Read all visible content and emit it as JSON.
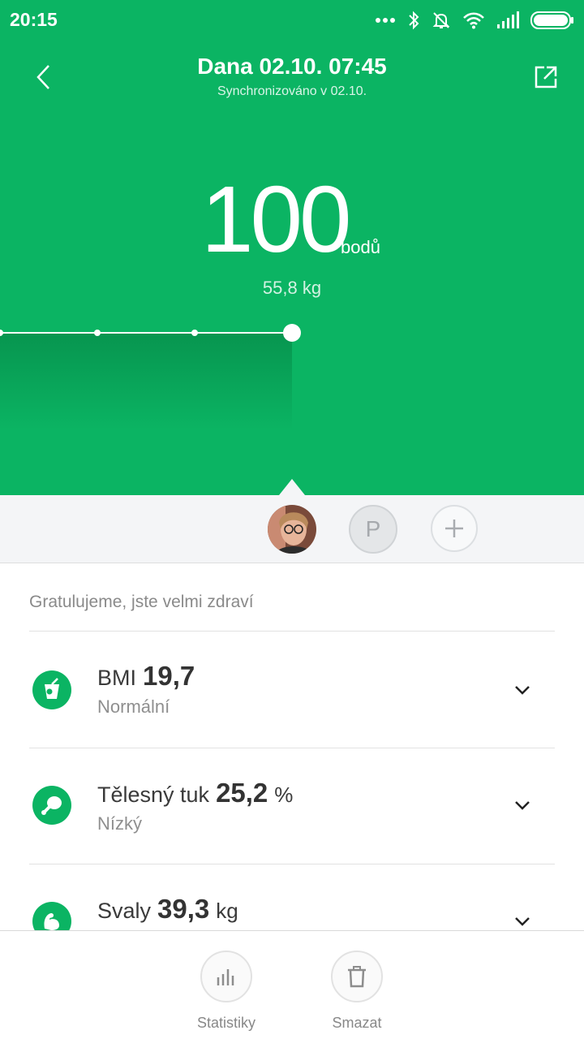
{
  "status_bar": {
    "time": "20:15",
    "icons": [
      "more-dots-icon",
      "bluetooth-icon",
      "bell-off-icon",
      "wifi-icon",
      "signal-icon",
      "battery-icon"
    ]
  },
  "header": {
    "title": "Dana 02.10. 07:45",
    "subtitle": "Synchronizováno v 02.10."
  },
  "score": {
    "value": "100",
    "unit": "bodů",
    "weight": "55,8 kg"
  },
  "users": {
    "second_user_initial": "P"
  },
  "summary": {
    "text": "Gratulujeme, jste velmi zdraví"
  },
  "metrics": [
    {
      "name": "BMI",
      "value": "19,7",
      "unit": "",
      "status": "Normální",
      "icon": "drink-icon"
    },
    {
      "name": "Tělesný tuk",
      "value": "25,2",
      "unit": "%",
      "status": "Nízký",
      "icon": "drumstick-icon"
    },
    {
      "name": "Svaly",
      "value": "39,3",
      "unit": "kg",
      "status": "",
      "icon": "muscle-arm-icon"
    }
  ],
  "bottom_bar": {
    "stats_label": "Statistiky",
    "delete_label": "Smazat"
  },
  "colors": {
    "accent": "#0bb463",
    "chart_fill": "#089a55",
    "background_light": "#f4f5f7"
  }
}
